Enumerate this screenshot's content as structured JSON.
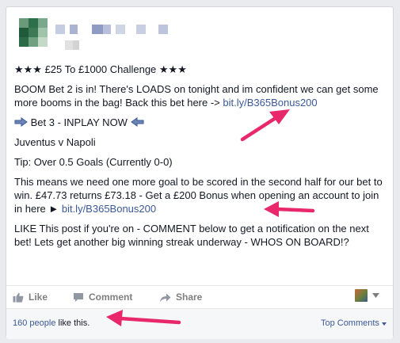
{
  "post": {
    "title": "★★★ £25 To £1000 Challenge ★★★",
    "p1_text": "BOOM Bet 2 is in! There's LOADS on tonight and im confident we can get some more booms in the bag! Back this bet here -> ",
    "p1_link": "bit.ly/B365Bonus200",
    "bet_label": "Bet 3 - INPLAY NOW",
    "match": "Juventus v Napoli",
    "tip": "Tip: Over 0.5 Goals (Currently 0-0)",
    "p2_text": "This means we need one more goal to be scored in the second half for our bet to win. £47.73 returns £73.18 - Get a £200 Bonus when opening an account to join in here ► ",
    "p2_link": "bit.ly/B365Bonus200",
    "p3_text": "LIKE This post if you're on - COMMENT below to get a notification on the next bet! Lets get another big winning streak underway - WHOS ON BOARD!?"
  },
  "actions": {
    "like": "Like",
    "comment": "Comment",
    "share": "Share"
  },
  "footer": {
    "likes_count": "160 people",
    "likes_suffix": " like this.",
    "top_comments": "Top Comments"
  },
  "icons": {
    "like": "thumbs-up-icon",
    "comment": "speech-bubble-icon",
    "share": "share-arrow-icon",
    "arrow_right": "arrow-right-icon",
    "arrow_left": "arrow-left-icon",
    "annotation": "pink-arrow-annotation"
  },
  "colors": {
    "link": "#3b5998",
    "annotation": "#e8286b",
    "action_text": "#7f7f7f"
  }
}
